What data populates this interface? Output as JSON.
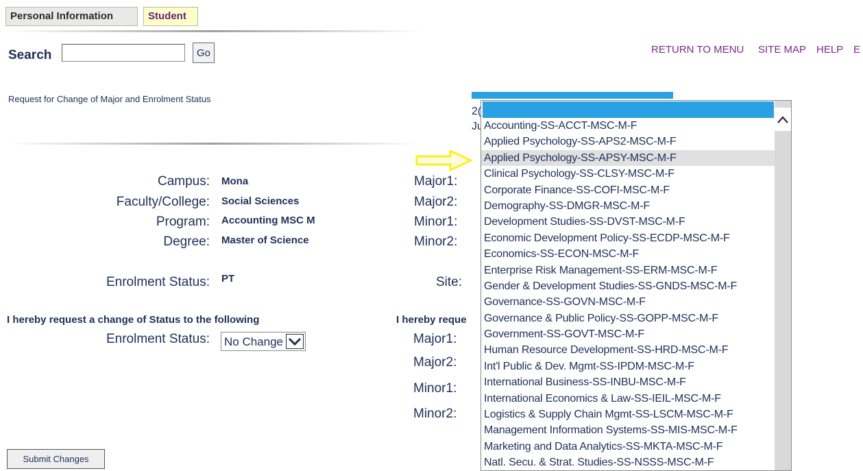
{
  "tabs": {
    "personal": "Personal Information",
    "student": "Student"
  },
  "search": {
    "label": "Search",
    "value": "",
    "go_label": "Go"
  },
  "topnav": {
    "return": "RETURN TO MENU",
    "sitemap": "SITE MAP",
    "help": "HELP",
    "cut": "E"
  },
  "page": {
    "heading": "Request for Change of Major and Enrolment Status"
  },
  "info": {
    "campus_label": "Campus:",
    "campus_value": "Mona",
    "faculty_label": "Faculty/College:",
    "faculty_value": "Social Sciences",
    "program_label": "Program:",
    "program_value": "Accounting MSC M",
    "degree_label": "Degree:",
    "degree_value": "Master of Science",
    "enrolment_label": "Enrolment Status:",
    "enrolment_value": "PT"
  },
  "right_labels": {
    "major1": "Major1:",
    "major2": "Major2:",
    "minor1": "Minor1:",
    "minor2": "Minor2:",
    "site": "Site:"
  },
  "change_request": {
    "status_heading": "I hereby request a change of Status to the following",
    "right_heading_partial": "I hereby reque",
    "enrolment_label": "Enrolment Status:",
    "enrolment_selected": "No Change",
    "major1": "Major1:",
    "major2": "Major2:",
    "minor1": "Minor1:",
    "minor2": "Minor2:"
  },
  "partial_text": {
    "l1": "2(",
    "l2": "Ju"
  },
  "submit_label": "Submit Changes",
  "dropdown": {
    "options": [
      "Accounting-SS-ACCT-MSC-M-F",
      "Applied Psychology-SS-APS2-MSC-M-F",
      "Applied Psychology-SS-APSY-MSC-M-F",
      "Clinical Psychology-SS-CLSY-MSC-M-F",
      "Corporate Finance-SS-COFI-MSC-M-F",
      "Demography-SS-DMGR-MSC-M-F",
      "Development Studies-SS-DVST-MSC-M-F",
      "Economic Development Policy-SS-ECDP-MSC-M-F",
      "Economics-SS-ECON-MSC-M-F",
      "Enterprise Risk Management-SS-ERM-MSC-M-F",
      "Gender & Development Studies-SS-GNDS-MSC-M-F",
      "Governance-SS-GOVN-MSC-M-F",
      "Governance & Public Policy-SS-GOPP-MSC-M-F",
      "Government-SS-GOVT-MSC-M-F",
      "Human Resource Development-SS-HRD-MSC-M-F",
      "Int'l Public & Dev. Mgmt-SS-IPDM-MSC-M-F",
      "International Business-SS-INBU-MSC-M-F",
      "International Economics & Law-SS-IEIL-MSC-M-F",
      "Logistics & Supply Chain Mgmt-SS-LSCM-MSC-M-F",
      "Management Information Systems-SS-MIS-MSC-M-F",
      "Marketing and Data Analytics-SS-MKTA-MSC-M-F",
      "Natl. Secu. & Strat. Studies-SS-NSSS-MSC-M-F"
    ],
    "highlighted_index": 2
  },
  "colors": {
    "accent_blue": "#29a1e2",
    "arrow_yellow": "#f7f21c",
    "nav_purple": "#7a2a8a"
  }
}
